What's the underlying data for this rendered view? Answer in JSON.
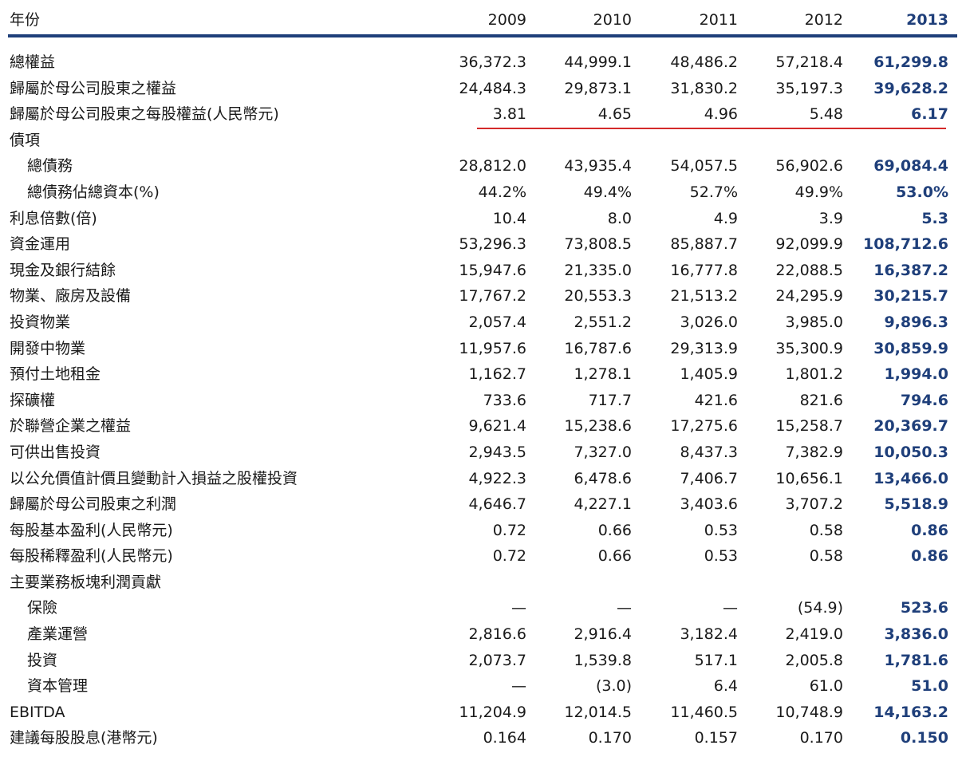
{
  "header": {
    "label": "年份",
    "years": [
      "2009",
      "2010",
      "2011",
      "2012",
      "2013"
    ]
  },
  "rows": [
    {
      "label": "總權益",
      "indent": false,
      "values": [
        "36,372.3",
        "44,999.1",
        "48,486.2",
        "57,218.4",
        "61,299.8"
      ]
    },
    {
      "label": "歸屬於母公司股東之權益",
      "indent": false,
      "values": [
        "24,484.3",
        "29,873.1",
        "31,830.2",
        "35,197.3",
        "39,628.2"
      ]
    },
    {
      "label": "歸屬於母公司股東之每股權益(人民幣元)",
      "indent": false,
      "values": [
        "3.81",
        "4.65",
        "4.96",
        "5.48",
        "6.17"
      ]
    },
    {
      "label": "債項",
      "indent": false,
      "values": [
        "",
        "",
        "",
        "",
        ""
      ]
    },
    {
      "label": "總債務",
      "indent": true,
      "values": [
        "28,812.0",
        "43,935.4",
        "54,057.5",
        "56,902.6",
        "69,084.4"
      ]
    },
    {
      "label": "總債務佔總資本(%)",
      "indent": true,
      "values": [
        "44.2%",
        "49.4%",
        "52.7%",
        "49.9%",
        "53.0%"
      ]
    },
    {
      "label": "利息倍數(倍)",
      "indent": false,
      "values": [
        "10.4",
        "8.0",
        "4.9",
        "3.9",
        "5.3"
      ]
    },
    {
      "label": "資金運用",
      "indent": false,
      "values": [
        "53,296.3",
        "73,808.5",
        "85,887.7",
        "92,099.9",
        "108,712.6"
      ]
    },
    {
      "label": "現金及銀行結餘",
      "indent": false,
      "values": [
        "15,947.6",
        "21,335.0",
        "16,777.8",
        "22,088.5",
        "16,387.2"
      ]
    },
    {
      "label": "物業、廠房及設備",
      "indent": false,
      "values": [
        "17,767.2",
        "20,553.3",
        "21,513.2",
        "24,295.9",
        "30,215.7"
      ]
    },
    {
      "label": "投資物業",
      "indent": false,
      "values": [
        "2,057.4",
        "2,551.2",
        "3,026.0",
        "3,985.0",
        "9,896.3"
      ]
    },
    {
      "label": "開發中物業",
      "indent": false,
      "values": [
        "11,957.6",
        "16,787.6",
        "29,313.9",
        "35,300.9",
        "30,859.9"
      ]
    },
    {
      "label": "預付土地租金",
      "indent": false,
      "values": [
        "1,162.7",
        "1,278.1",
        "1,405.9",
        "1,801.2",
        "1,994.0"
      ]
    },
    {
      "label": "探礦權",
      "indent": false,
      "values": [
        "733.6",
        "717.7",
        "421.6",
        "821.6",
        "794.6"
      ]
    },
    {
      "label": "於聯營企業之權益",
      "indent": false,
      "values": [
        "9,621.4",
        "15,238.6",
        "17,275.6",
        "15,258.7",
        "20,369.7"
      ]
    },
    {
      "label": "可供出售投資",
      "indent": false,
      "values": [
        "2,943.5",
        "7,327.0",
        "8,437.3",
        "7,382.9",
        "10,050.3"
      ]
    },
    {
      "label": "以公允價值計價且變動計入損益之股權投資",
      "indent": false,
      "values": [
        "4,922.3",
        "6,478.6",
        "7,406.7",
        "10,656.1",
        "13,466.0"
      ]
    },
    {
      "label": "歸屬於母公司股東之利潤",
      "indent": false,
      "values": [
        "4,646.7",
        "4,227.1",
        "3,403.6",
        "3,707.2",
        "5,518.9"
      ]
    },
    {
      "label": "每股基本盈利(人民幣元)",
      "indent": false,
      "values": [
        "0.72",
        "0.66",
        "0.53",
        "0.58",
        "0.86"
      ]
    },
    {
      "label": "每股稀釋盈利(人民幣元)",
      "indent": false,
      "values": [
        "0.72",
        "0.66",
        "0.53",
        "0.58",
        "0.86"
      ]
    },
    {
      "label": "主要業務板塊利潤貢獻",
      "indent": false,
      "values": [
        "",
        "",
        "",
        "",
        ""
      ]
    },
    {
      "label": "保險",
      "indent": true,
      "values": [
        "—",
        "—",
        "—",
        "(54.9)",
        "523.6"
      ]
    },
    {
      "label": "產業運營",
      "indent": true,
      "values": [
        "2,816.6",
        "2,916.4",
        "3,182.4",
        "2,419.0",
        "3,836.0"
      ]
    },
    {
      "label": "投資",
      "indent": true,
      "values": [
        "2,073.7",
        "1,539.8",
        "517.1",
        "2,005.8",
        "1,781.6"
      ]
    },
    {
      "label": "資本管理",
      "indent": true,
      "values": [
        "—",
        "(3.0)",
        "6.4",
        "61.0",
        "51.0"
      ]
    },
    {
      "label": "EBITDA",
      "indent": false,
      "values": [
        "11,204.9",
        "12,014.5",
        "11,460.5",
        "10,748.9",
        "14,163.2"
      ]
    },
    {
      "label": "建議每股股息(港幣元)",
      "indent": false,
      "values": [
        "0.164",
        "0.170",
        "0.157",
        "0.170",
        "0.150"
      ]
    }
  ]
}
